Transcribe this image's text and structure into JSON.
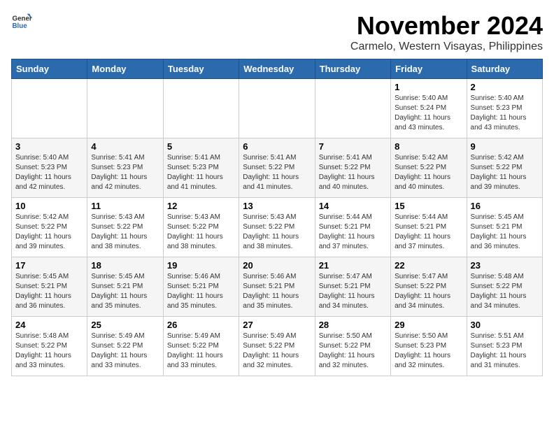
{
  "header": {
    "logo_line1": "General",
    "logo_line2": "Blue",
    "title": "November 2024",
    "subtitle": "Carmelo, Western Visayas, Philippines"
  },
  "weekdays": [
    "Sunday",
    "Monday",
    "Tuesday",
    "Wednesday",
    "Thursday",
    "Friday",
    "Saturday"
  ],
  "weeks": [
    [
      {
        "day": "",
        "info": ""
      },
      {
        "day": "",
        "info": ""
      },
      {
        "day": "",
        "info": ""
      },
      {
        "day": "",
        "info": ""
      },
      {
        "day": "",
        "info": ""
      },
      {
        "day": "1",
        "info": "Sunrise: 5:40 AM\nSunset: 5:24 PM\nDaylight: 11 hours\nand 43 minutes."
      },
      {
        "day": "2",
        "info": "Sunrise: 5:40 AM\nSunset: 5:23 PM\nDaylight: 11 hours\nand 43 minutes."
      }
    ],
    [
      {
        "day": "3",
        "info": "Sunrise: 5:40 AM\nSunset: 5:23 PM\nDaylight: 11 hours\nand 42 minutes."
      },
      {
        "day": "4",
        "info": "Sunrise: 5:41 AM\nSunset: 5:23 PM\nDaylight: 11 hours\nand 42 minutes."
      },
      {
        "day": "5",
        "info": "Sunrise: 5:41 AM\nSunset: 5:23 PM\nDaylight: 11 hours\nand 41 minutes."
      },
      {
        "day": "6",
        "info": "Sunrise: 5:41 AM\nSunset: 5:22 PM\nDaylight: 11 hours\nand 41 minutes."
      },
      {
        "day": "7",
        "info": "Sunrise: 5:41 AM\nSunset: 5:22 PM\nDaylight: 11 hours\nand 40 minutes."
      },
      {
        "day": "8",
        "info": "Sunrise: 5:42 AM\nSunset: 5:22 PM\nDaylight: 11 hours\nand 40 minutes."
      },
      {
        "day": "9",
        "info": "Sunrise: 5:42 AM\nSunset: 5:22 PM\nDaylight: 11 hours\nand 39 minutes."
      }
    ],
    [
      {
        "day": "10",
        "info": "Sunrise: 5:42 AM\nSunset: 5:22 PM\nDaylight: 11 hours\nand 39 minutes."
      },
      {
        "day": "11",
        "info": "Sunrise: 5:43 AM\nSunset: 5:22 PM\nDaylight: 11 hours\nand 38 minutes."
      },
      {
        "day": "12",
        "info": "Sunrise: 5:43 AM\nSunset: 5:22 PM\nDaylight: 11 hours\nand 38 minutes."
      },
      {
        "day": "13",
        "info": "Sunrise: 5:43 AM\nSunset: 5:22 PM\nDaylight: 11 hours\nand 38 minutes."
      },
      {
        "day": "14",
        "info": "Sunrise: 5:44 AM\nSunset: 5:21 PM\nDaylight: 11 hours\nand 37 minutes."
      },
      {
        "day": "15",
        "info": "Sunrise: 5:44 AM\nSunset: 5:21 PM\nDaylight: 11 hours\nand 37 minutes."
      },
      {
        "day": "16",
        "info": "Sunrise: 5:45 AM\nSunset: 5:21 PM\nDaylight: 11 hours\nand 36 minutes."
      }
    ],
    [
      {
        "day": "17",
        "info": "Sunrise: 5:45 AM\nSunset: 5:21 PM\nDaylight: 11 hours\nand 36 minutes."
      },
      {
        "day": "18",
        "info": "Sunrise: 5:45 AM\nSunset: 5:21 PM\nDaylight: 11 hours\nand 35 minutes."
      },
      {
        "day": "19",
        "info": "Sunrise: 5:46 AM\nSunset: 5:21 PM\nDaylight: 11 hours\nand 35 minutes."
      },
      {
        "day": "20",
        "info": "Sunrise: 5:46 AM\nSunset: 5:21 PM\nDaylight: 11 hours\nand 35 minutes."
      },
      {
        "day": "21",
        "info": "Sunrise: 5:47 AM\nSunset: 5:21 PM\nDaylight: 11 hours\nand 34 minutes."
      },
      {
        "day": "22",
        "info": "Sunrise: 5:47 AM\nSunset: 5:22 PM\nDaylight: 11 hours\nand 34 minutes."
      },
      {
        "day": "23",
        "info": "Sunrise: 5:48 AM\nSunset: 5:22 PM\nDaylight: 11 hours\nand 34 minutes."
      }
    ],
    [
      {
        "day": "24",
        "info": "Sunrise: 5:48 AM\nSunset: 5:22 PM\nDaylight: 11 hours\nand 33 minutes."
      },
      {
        "day": "25",
        "info": "Sunrise: 5:49 AM\nSunset: 5:22 PM\nDaylight: 11 hours\nand 33 minutes."
      },
      {
        "day": "26",
        "info": "Sunrise: 5:49 AM\nSunset: 5:22 PM\nDaylight: 11 hours\nand 33 minutes."
      },
      {
        "day": "27",
        "info": "Sunrise: 5:49 AM\nSunset: 5:22 PM\nDaylight: 11 hours\nand 32 minutes."
      },
      {
        "day": "28",
        "info": "Sunrise: 5:50 AM\nSunset: 5:22 PM\nDaylight: 11 hours\nand 32 minutes."
      },
      {
        "day": "29",
        "info": "Sunrise: 5:50 AM\nSunset: 5:23 PM\nDaylight: 11 hours\nand 32 minutes."
      },
      {
        "day": "30",
        "info": "Sunrise: 5:51 AM\nSunset: 5:23 PM\nDaylight: 11 hours\nand 31 minutes."
      }
    ]
  ]
}
